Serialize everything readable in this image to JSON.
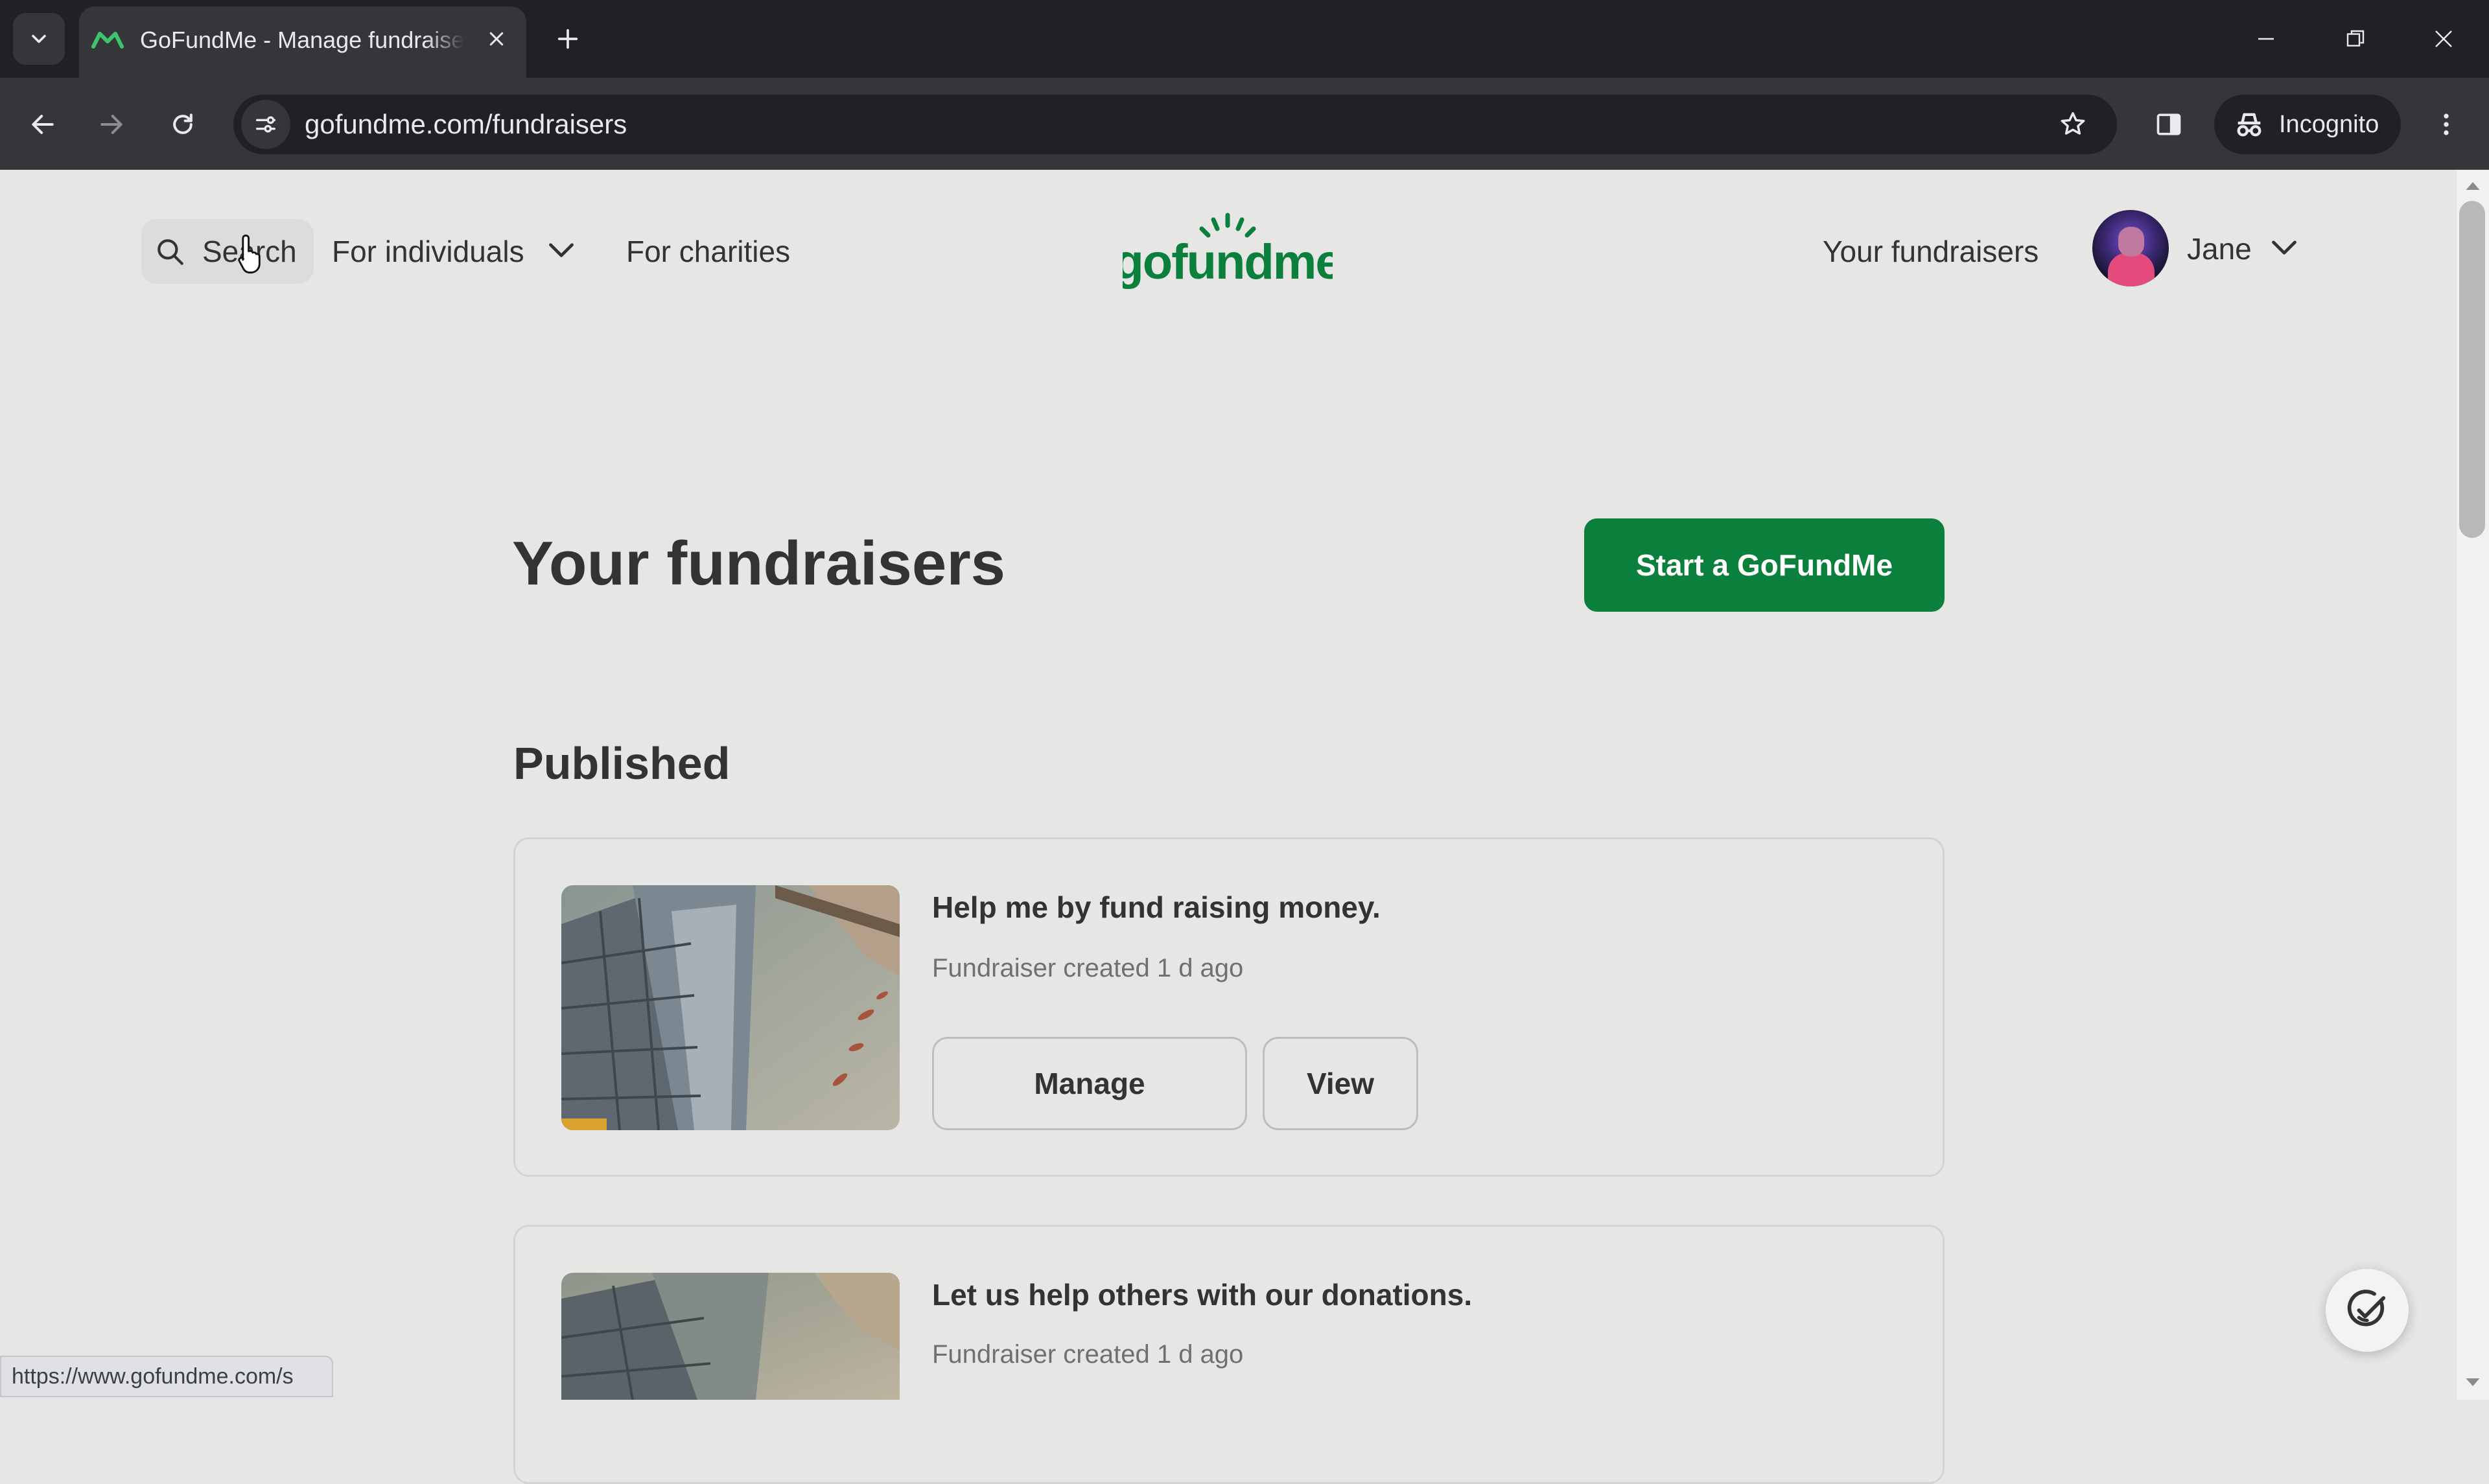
{
  "browser": {
    "tab": {
      "title": "GoFundMe - Manage fundraisers"
    },
    "url": "gofundme.com/fundraisers",
    "incognito_label": "Incognito",
    "status_url": "https://www.gofundme.com/s"
  },
  "header": {
    "search_label": "Search",
    "nav": {
      "individuals": "For individuals",
      "charities": "For charities",
      "your_fundraisers": "Your fundraisers"
    },
    "logo_text": "gofundme",
    "user_name": "Jane"
  },
  "main": {
    "title": "Your fundraisers",
    "start_button": "Start a GoFundMe",
    "section_title": "Published",
    "fundraisers": [
      {
        "title": "Help me by fund raising money.",
        "meta": "Fundraiser created 1 d ago",
        "manage_label": "Manage",
        "view_label": "View"
      },
      {
        "title": "Let us help others with our donations.",
        "meta": "Fundraiser created 1 d ago"
      }
    ]
  },
  "colors": {
    "brand_green": "#0b7f3c",
    "page_bg": "#e6e6e5",
    "chrome_dark": "#202124",
    "chrome_toolbar": "#35363a"
  },
  "icons": [
    "tab-search-icon",
    "gofundme-favicon",
    "close-icon",
    "plus-icon",
    "minimize-icon",
    "restore-icon",
    "back-icon",
    "forward-icon",
    "reload-icon",
    "site-info-icon",
    "star-icon",
    "side-panel-icon",
    "incognito-icon",
    "more-vert-icon",
    "search-icon",
    "chevron-down-icon",
    "help-icon"
  ]
}
